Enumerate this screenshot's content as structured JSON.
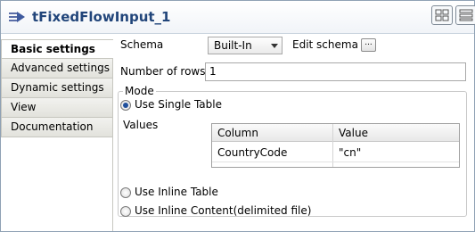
{
  "title": "tFixedFlowInput_1",
  "tabs": [
    {
      "label": "Basic settings",
      "active": true
    },
    {
      "label": "Advanced settings",
      "active": false
    },
    {
      "label": "Dynamic settings",
      "active": false
    },
    {
      "label": "View",
      "active": false
    },
    {
      "label": "Documentation",
      "active": false
    }
  ],
  "schema": {
    "label": "Schema",
    "value": "Built-In",
    "edit_label": "Edit schema",
    "dots_label": "..."
  },
  "rows": {
    "label": "Number of rows",
    "value": "1"
  },
  "mode": {
    "legend": "Mode",
    "options": [
      {
        "label": "Use Single Table",
        "checked": true
      },
      {
        "label": "Use Inline Table",
        "checked": false
      },
      {
        "label": "Use Inline Content(delimited file)",
        "checked": false
      }
    ],
    "values_label": "Values",
    "table": {
      "headers": [
        "Column",
        "Value"
      ],
      "rows": [
        [
          "CountryCode",
          "\"cn\""
        ]
      ]
    }
  },
  "colors": {
    "title": "#21457a",
    "accent": "#1f4f9c"
  },
  "icons": [
    "flow-arrow-icon",
    "layout-grid-icon",
    "layout-list-icon",
    "dropdown-arrow-icon"
  ]
}
